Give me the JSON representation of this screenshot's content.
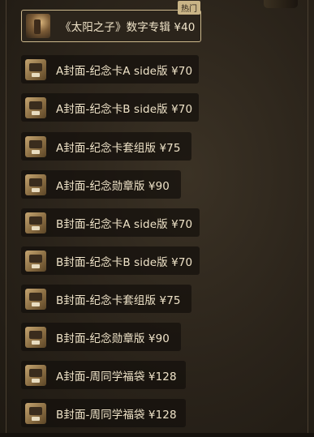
{
  "items": [
    {
      "label": "《太阳之子》数字专辑  ¥40",
      "badge": "热门",
      "selected": true,
      "icon": "album-cover-icon"
    },
    {
      "label": "A封面-纪念卡A side版  ¥70",
      "icon": "photo-card-icon"
    },
    {
      "label": "A封面-纪念卡B side版  ¥70",
      "icon": "photo-card-icon"
    },
    {
      "label": "A封面-纪念卡套组版  ¥75",
      "icon": "photo-card-icon"
    },
    {
      "label": "A封面-纪念勋章版  ¥90",
      "icon": "photo-card-icon"
    },
    {
      "label": "B封面-纪念卡A side版  ¥70",
      "icon": "photo-card-icon"
    },
    {
      "label": "B封面-纪念卡B side版  ¥70",
      "icon": "photo-card-icon"
    },
    {
      "label": "B封面-纪念卡套组版  ¥75",
      "icon": "photo-card-icon"
    },
    {
      "label": "B封面-纪念勋章版  ¥90",
      "icon": "photo-card-icon"
    },
    {
      "label": "A封面-周同学福袋  ¥128",
      "icon": "lucky-bag-icon"
    },
    {
      "label": "B封面-周同学福袋  ¥128",
      "icon": "lucky-bag-icon"
    }
  ]
}
